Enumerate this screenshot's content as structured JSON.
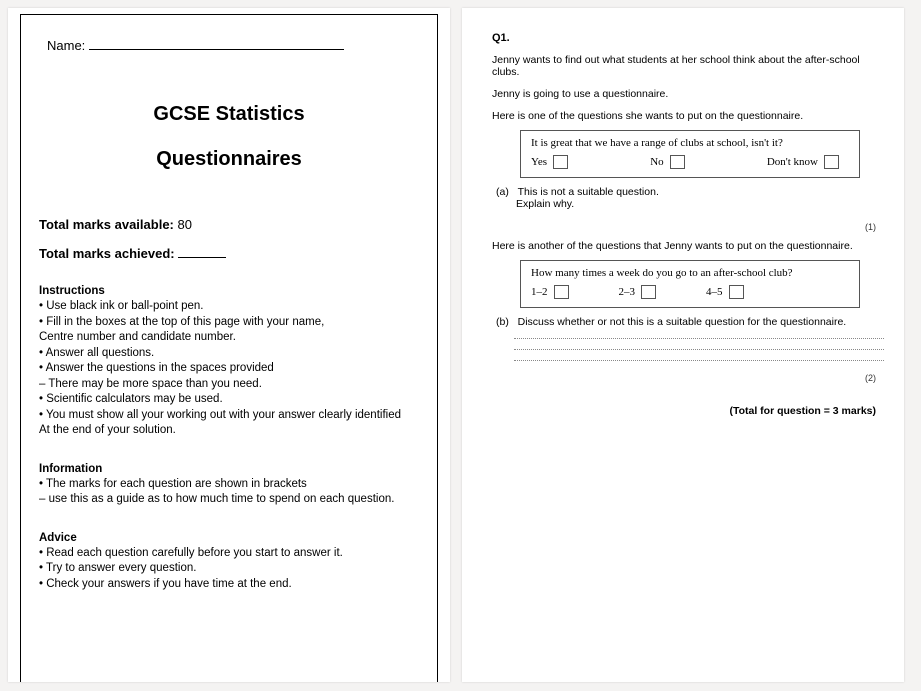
{
  "cover": {
    "name_label": "Name:",
    "title1": "GCSE Statistics",
    "title2": "Questionnaires",
    "total_avail_label": "Total marks available: ",
    "total_avail_value": "80",
    "total_achieved_label": "Total marks achieved: ",
    "instructions_head": "Instructions",
    "instructions": [
      "• Use black ink or ball-point pen.",
      "• Fill in the boxes at the top of this page with your name,",
      "Centre number and candidate number.",
      "• Answer all questions.",
      "• Answer the questions in the spaces provided",
      "– There may be more space than you need.",
      "• Scientific calculators may be used.",
      "• You must show all your working out with your answer clearly identified",
      "At the end of your solution."
    ],
    "information_head": "Information",
    "information": [
      "• The marks for each question are shown in brackets",
      "– use this as a guide as to how much time to spend on each question."
    ],
    "advice_head": "Advice",
    "advice": [
      "• Read each question carefully before you start to answer it.",
      "• Try to answer every question.",
      "• Check your answers if you have time at the end."
    ]
  },
  "q1": {
    "label": "Q1.",
    "intro1": "Jenny wants to find out what students at her school think about the after-school clubs.",
    "intro2": "Jenny is going to use a questionnaire.",
    "intro3": "Here is one of the questions she wants to put on the questionnaire.",
    "box1_prompt": "It is great that we have a range of clubs at school, isn't it?",
    "box1_opts": [
      "Yes",
      "No",
      "Don't know"
    ],
    "a_lbl": "(a)",
    "a_line1": "This is not a suitable question.",
    "a_line2": "Explain why.",
    "a_marks": "(1)",
    "intro4": "Here is another of the questions that Jenny wants to put on the questionnaire.",
    "box2_prompt": "How many times a week do you go to an after-school club?",
    "box2_opts": [
      "1–2",
      "2–3",
      "4–5"
    ],
    "b_lbl": "(b)",
    "b_line1": "Discuss whether or not this is a suitable question for the questionnaire.",
    "b_marks": "(2)",
    "total": "(Total for question = 3 marks)"
  }
}
